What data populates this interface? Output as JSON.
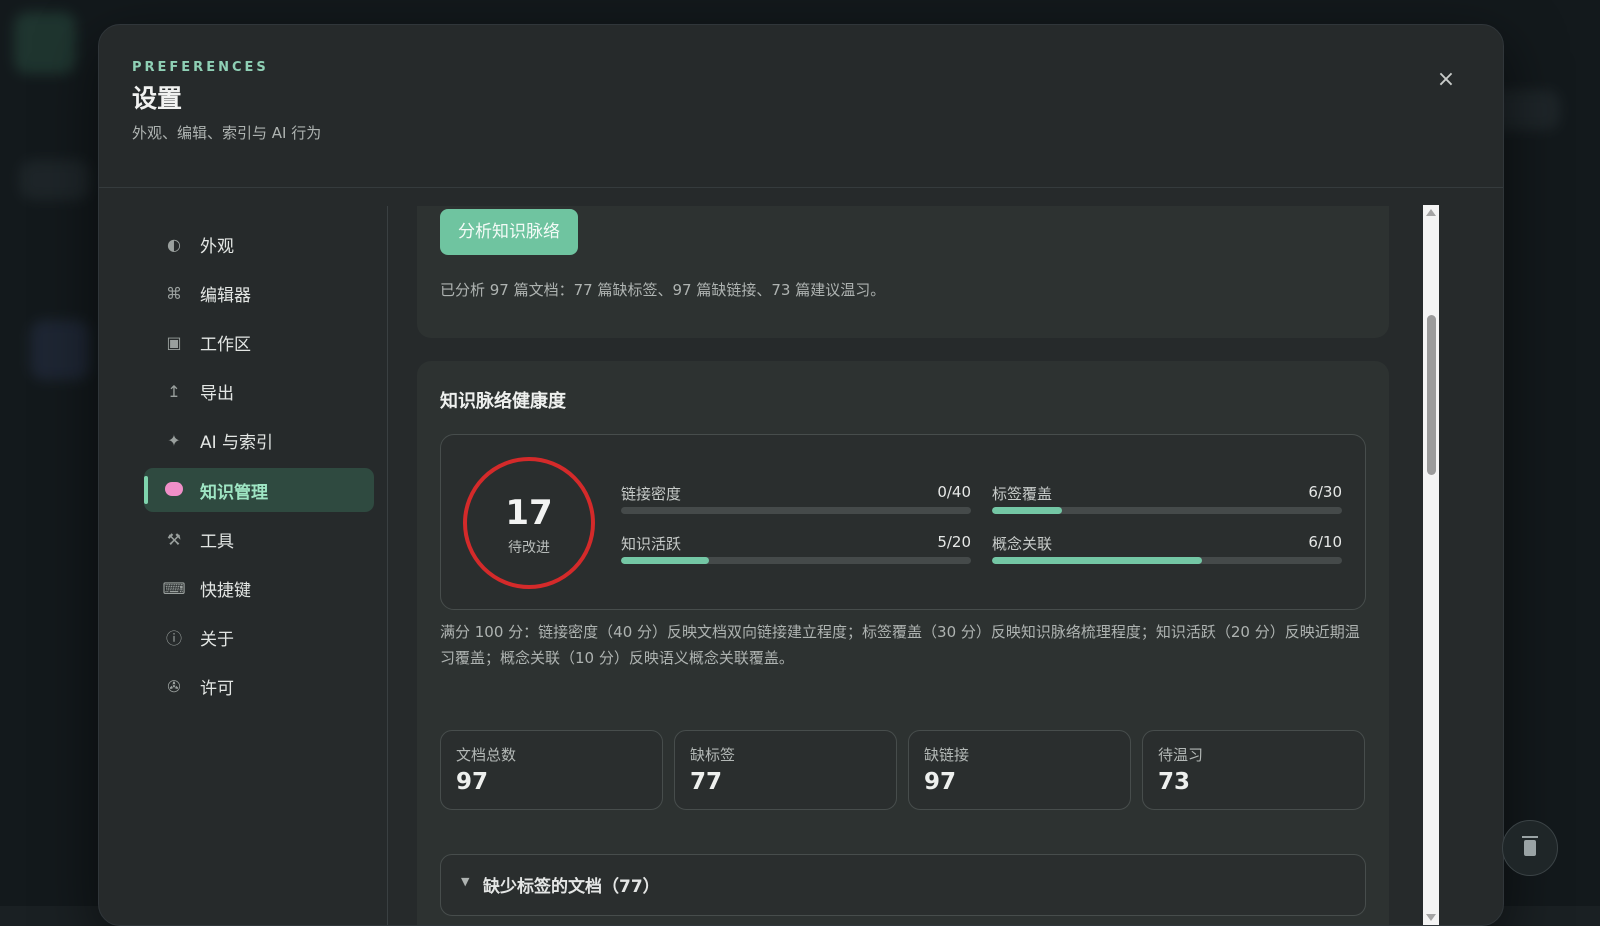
{
  "header": {
    "eyebrow": "PREFERENCES",
    "title": "设置",
    "subtitle": "外观、编辑、索引与 AI 行为",
    "close_icon": "×"
  },
  "sidebar": {
    "items": [
      {
        "label": "外观",
        "icon": "◐",
        "icon_name": "contrast-icon",
        "active": false
      },
      {
        "label": "编辑器",
        "icon": "⌘",
        "icon_name": "command-icon",
        "active": false
      },
      {
        "label": "工作区",
        "icon": "▣",
        "icon_name": "workspace-icon",
        "active": false
      },
      {
        "label": "导出",
        "icon": "↥",
        "icon_name": "export-icon",
        "active": false
      },
      {
        "label": "AI 与索引",
        "icon": "✦",
        "icon_name": "sparkle-icon",
        "active": false
      },
      {
        "label": "知识管理",
        "icon": "",
        "icon_name": "brain-icon",
        "active": true
      },
      {
        "label": "工具",
        "icon": "⚒",
        "icon_name": "tools-icon",
        "active": false
      },
      {
        "label": "快捷键",
        "icon": "⌨",
        "icon_name": "keyboard-icon",
        "active": false
      },
      {
        "label": "关于",
        "icon": "ⓘ",
        "icon_name": "info-icon",
        "active": false
      },
      {
        "label": "许可",
        "icon": "✇",
        "icon_name": "license-icon",
        "active": false
      }
    ]
  },
  "analysis": {
    "button_label": "分析知识脉络",
    "summary": "已分析 97 篇文档：77 篇缺标签、97 篇缺链接、73 篇建议温习。"
  },
  "health": {
    "section_title": "知识脉络健康度",
    "score": "17",
    "score_label": "待改进",
    "metrics": [
      {
        "name": "链接密度",
        "value": "0/40",
        "fraction": 0.0
      },
      {
        "name": "标签覆盖",
        "value": "6/30",
        "fraction": 0.2
      },
      {
        "name": "知识活跃",
        "value": "5/20",
        "fraction": 0.25
      },
      {
        "name": "概念关联",
        "value": "6/10",
        "fraction": 0.6
      }
    ],
    "description": "满分 100 分：链接密度（40 分）反映文档双向链接建立程度；标签覆盖（30 分）反映知识脉络梳理程度；知识活跃（20 分）反映近期温习覆盖；概念关联（10 分）反映语义概念关联覆盖。"
  },
  "stats": [
    {
      "label": "文档总数",
      "value": "97"
    },
    {
      "label": "缺标签",
      "value": "77"
    },
    {
      "label": "缺链接",
      "value": "97"
    },
    {
      "label": "待温习",
      "value": "73"
    }
  ],
  "collapsible": {
    "caret": "▼",
    "label": "缺少标签的文档（77）"
  },
  "colors": {
    "accent": "#6fc4a0",
    "score_ring": "#d42a2a",
    "active_nav_bg": "#2f4a40"
  }
}
